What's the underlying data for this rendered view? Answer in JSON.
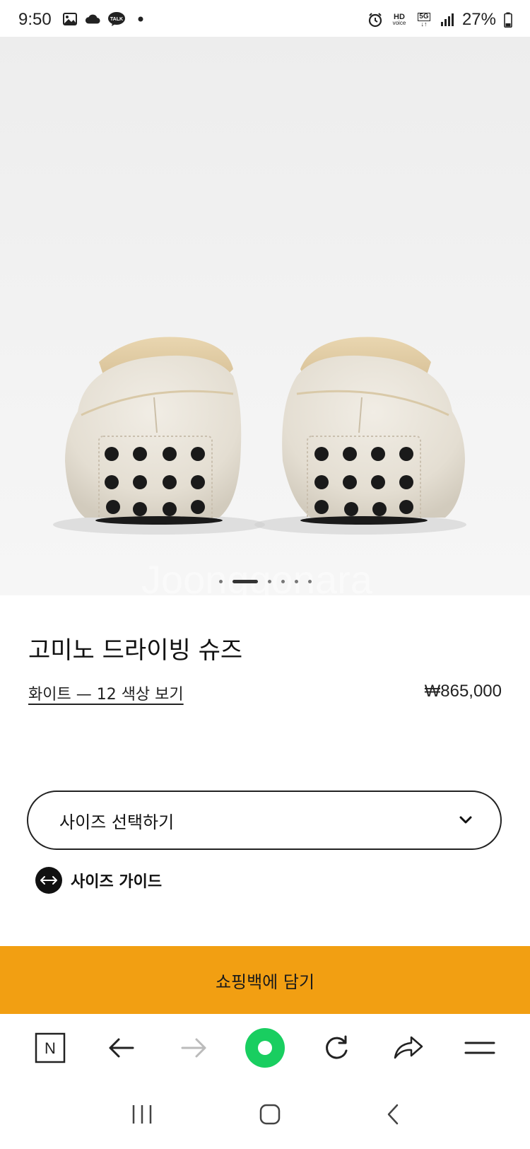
{
  "status_bar": {
    "time": "9:50",
    "icons": [
      "gallery-icon",
      "cloud-icon",
      "kakaotalk-icon",
      "dot-icon"
    ],
    "talk_label": "TALK",
    "right_icons": [
      "alarm-icon",
      "hd-voice-icon",
      "5g-icon",
      "signal-icon",
      "battery-icon"
    ],
    "hd_label": "HD",
    "voice_label": "voice",
    "network_label": "5G",
    "battery": "27%"
  },
  "hero": {
    "image_subject": "pair of white leather driving shoes with black rubber pebble soles, rear view",
    "watermark": "Joonggonara",
    "carousel_count": 6,
    "carousel_active_index": 1
  },
  "product": {
    "title": "고미노 드라이빙 슈즈",
    "color_link": "화이트 — 12 색상 보기",
    "price": "₩865,000"
  },
  "size_select": {
    "label": "사이즈 선택하기"
  },
  "size_guide": {
    "label": "사이즈 가이드"
  },
  "cart_button": {
    "label": "쇼핑백에 담기"
  },
  "browser_bar": {
    "items": [
      "naver-n-icon",
      "back-arrow-icon",
      "forward-arrow-icon",
      "green-dot-icon",
      "refresh-icon",
      "share-icon",
      "menu-icon"
    ],
    "naver_letter": "N"
  },
  "colors": {
    "accent_orange": "#f29f12",
    "naver_green": "#19ce60"
  }
}
